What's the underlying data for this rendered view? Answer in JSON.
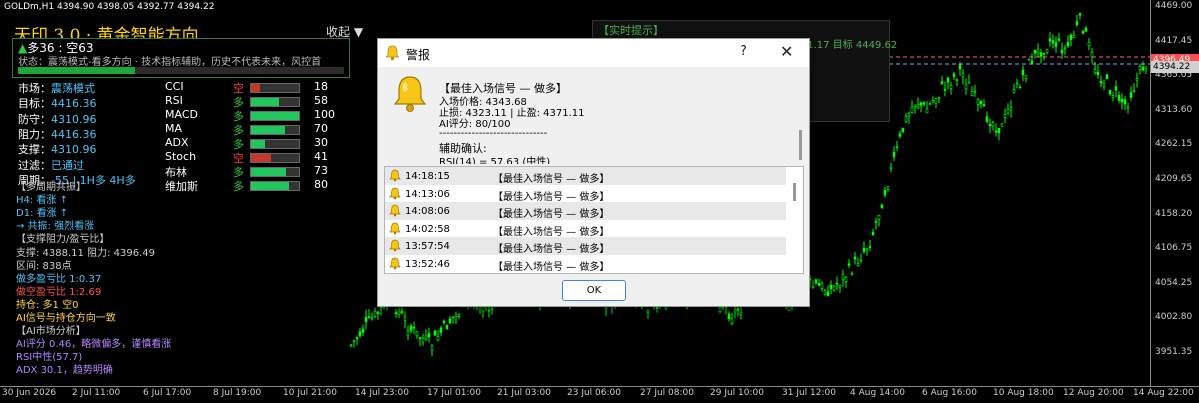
{
  "chart": {
    "symbol_line": "GOLDm,H1  4394.90 4398.05 4392.77 4394.22",
    "y_ticks": [
      "4469.00",
      "4417.45",
      "4365.05",
      "4313.60",
      "4262.15",
      "4209.65",
      "4158.20",
      "4106.75",
      "4054.25",
      "4002.80",
      "3951.35"
    ],
    "x_ticks": [
      "30 Jun 2026",
      "2 Jul 11:00",
      "6 Jul 17:00",
      "8 Jul 19:00",
      "10 Jul 21:00",
      "14 Jul 23:00",
      "17 Jul 01:00",
      "21 Jul 03:00",
      "23 Jul 06:00",
      "27 Jul 08:00",
      "29 Jul 10:00",
      "31 Jul 12:00",
      "4 Aug 14:00",
      "6 Aug 16:00",
      "10 Aug 18:00",
      "12 Aug 20:00",
      "14 Aug 22:00"
    ],
    "price_tags": [
      "4396.49",
      "4394.22"
    ],
    "colors": {
      "up": "#00ff00",
      "down": "#00ff00",
      "grid": "#1e3a1e",
      "tag_red": "#ff4d4d"
    }
  },
  "panel": {
    "title": "天印 3.0 · 黄金智能方向",
    "collapse": "收起 ▼",
    "bias_arrow": "▲",
    "bias_long": "多36",
    "bias_sep": " : ",
    "bias_short": "空63",
    "status": "状态：震荡模式-看多方向 · 技术指标辅助，历史不代表未来，风控首",
    "bias_fraction": 0.36,
    "rows": [
      {
        "k": "市场：",
        "v": "震荡模式"
      },
      {
        "k": "目标：",
        "v": "4416.36"
      },
      {
        "k": "防守：",
        "v": "4310.96"
      },
      {
        "k": "阻力：",
        "v": "4416.36"
      },
      {
        "k": "支撑：",
        "v": "4310.96"
      },
      {
        "k": "过滤：",
        "v": "已通过"
      },
      {
        "k": "周期：",
        "v": "-55 | 1H多 4H多"
      }
    ],
    "indicators": [
      {
        "name": "CCI",
        "dir": "空",
        "value": "18",
        "level": 0.18
      },
      {
        "name": "RSI",
        "dir": "多",
        "value": "58",
        "level": 0.58
      },
      {
        "name": "MACD",
        "dir": "多",
        "value": "100",
        "level": 1.0
      },
      {
        "name": "MA",
        "dir": "多",
        "value": "70",
        "level": 0.7
      },
      {
        "name": "ADX",
        "dir": "多",
        "value": "30",
        "level": 0.3
      },
      {
        "name": "Stoch",
        "dir": "空",
        "value": "41",
        "level": 0.41
      },
      {
        "name": "布林",
        "dir": "多",
        "value": "73",
        "level": 0.73
      },
      {
        "name": "维加斯",
        "dir": "多",
        "value": "80",
        "level": 0.8
      }
    ],
    "lower": [
      {
        "text": "【多周期共振】",
        "color": "#cccccc"
      },
      {
        "text": "H4: 看涨 ↑",
        "color": "#4fc3f7"
      },
      {
        "text": "D1: 看涨 ↑",
        "color": "#4fc3f7"
      },
      {
        "text": "→ 共振: 强烈看涨",
        "color": "#4fc3f7"
      },
      {
        "text": "【支撑阻力/盈亏比】",
        "color": "#cccccc"
      },
      {
        "text": "支撑: 4388.11  阻力: 4396.49",
        "color": "#cccccc"
      },
      {
        "text": "区间: 838点",
        "color": "#cccccc"
      },
      {
        "text": "做多盈亏比 1:0.37",
        "color": "#4fc3f7"
      },
      {
        "text": "做空盈亏比 1:2.69",
        "color": "#ff5252"
      },
      {
        "text": "持仓: 多1 空0",
        "color": "#ffd740"
      },
      {
        "text": "AI信号与持仓方向一致",
        "color": "#ffd740"
      },
      {
        "text": "【AI市场分析】",
        "color": "#cccccc"
      },
      {
        "text": "AI评分 0.46，略微偏多，谨慎看涨",
        "color": "#b388ff"
      },
      {
        "text": "RSI中性(57.7)",
        "color": "#b388ff"
      },
      {
        "text": "ADX 30.1，趋势明确",
        "color": "#b388ff"
      }
    ]
  },
  "hint": {
    "title": "【实时提示】",
    "line": "☆☆ 4343.68 (多)看多方向确认 · 止盈 4371.17 目标 4449.62"
  },
  "dialog": {
    "title": "警报",
    "help": "?",
    "close": "✕",
    "message": [
      "【最佳入场信号 — 做多】",
      "入场价格: 4343.68",
      "止损: 4323.11 | 止盈: 4371.11",
      "AI评分: 80/100",
      "------------------------------",
      "辅助确认:",
      "RSI(14) = 57.63 (中性)"
    ],
    "list": [
      {
        "time": "14:18:15",
        "msg": "【最佳入场信号 — 做多】"
      },
      {
        "time": "14:13:06",
        "msg": "【最佳入场信号 — 做多】"
      },
      {
        "time": "14:08:06",
        "msg": "【最佳入场信号 — 做多】"
      },
      {
        "time": "14:02:58",
        "msg": "【最佳入场信号 — 做多】"
      },
      {
        "time": "13:57:54",
        "msg": "【最佳入场信号 — 做多】"
      },
      {
        "time": "13:52:46",
        "msg": "【最佳入场信号 — 做多】"
      }
    ],
    "ok": "OK"
  }
}
